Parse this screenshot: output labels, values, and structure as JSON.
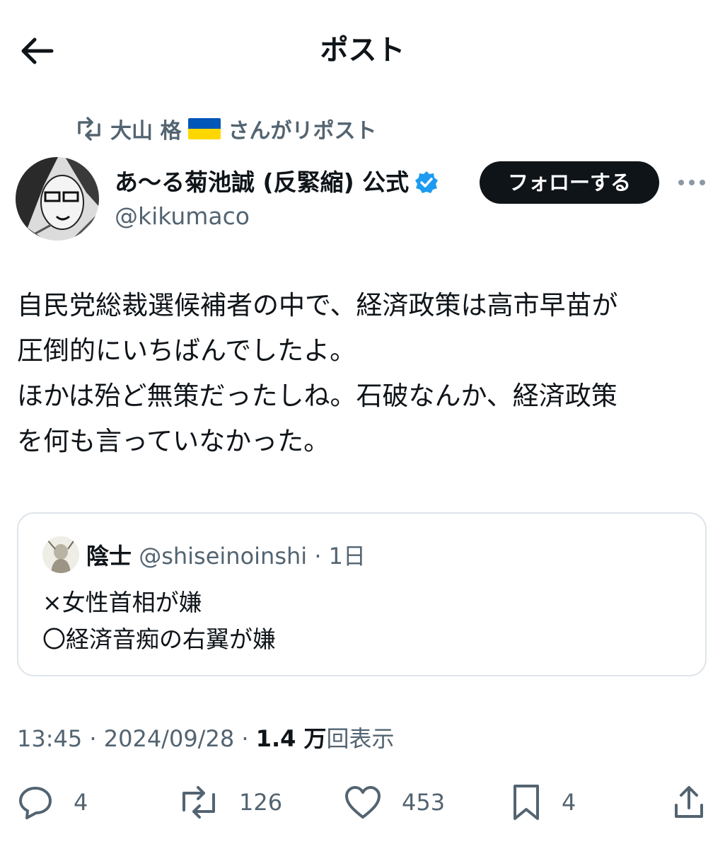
{
  "header": {
    "title": "ポスト"
  },
  "repost": {
    "user": "大山 格",
    "suffix": "さんがリポスト"
  },
  "author": {
    "name": "あ〜る菊池誠 (反緊縮) 公式",
    "handle": "@kikumaco"
  },
  "follow": {
    "label": "フォローする"
  },
  "tweet": {
    "lines": [
      "自民党総裁選候補者の中で、経済政策は高市早苗が",
      "圧倒的にいちばんでしたよ。",
      "ほかは殆ど無策だったしね。石破なんか、経済政策",
      "を何も言っていなかった。"
    ]
  },
  "quote": {
    "name": "陰士",
    "handle": "@shiseinoinshi",
    "time": "· 1日",
    "lines": [
      "×女性首相が嫌",
      "〇経済音痴の右翼が嫌"
    ]
  },
  "meta": {
    "time": "13:45",
    "sep1": "·",
    "date": "2024/09/28",
    "sep2": "·",
    "views": "1.4 万",
    "views_label": "回表示"
  },
  "actions": {
    "replies": "4",
    "reposts": "126",
    "likes": "453",
    "bookmarks": "4"
  },
  "colors": {
    "verified": "#1d9bf0",
    "muted": "#536471",
    "text": "#0f1419",
    "flag_blue": "#0057b7",
    "flag_yellow": "#ffd700"
  }
}
